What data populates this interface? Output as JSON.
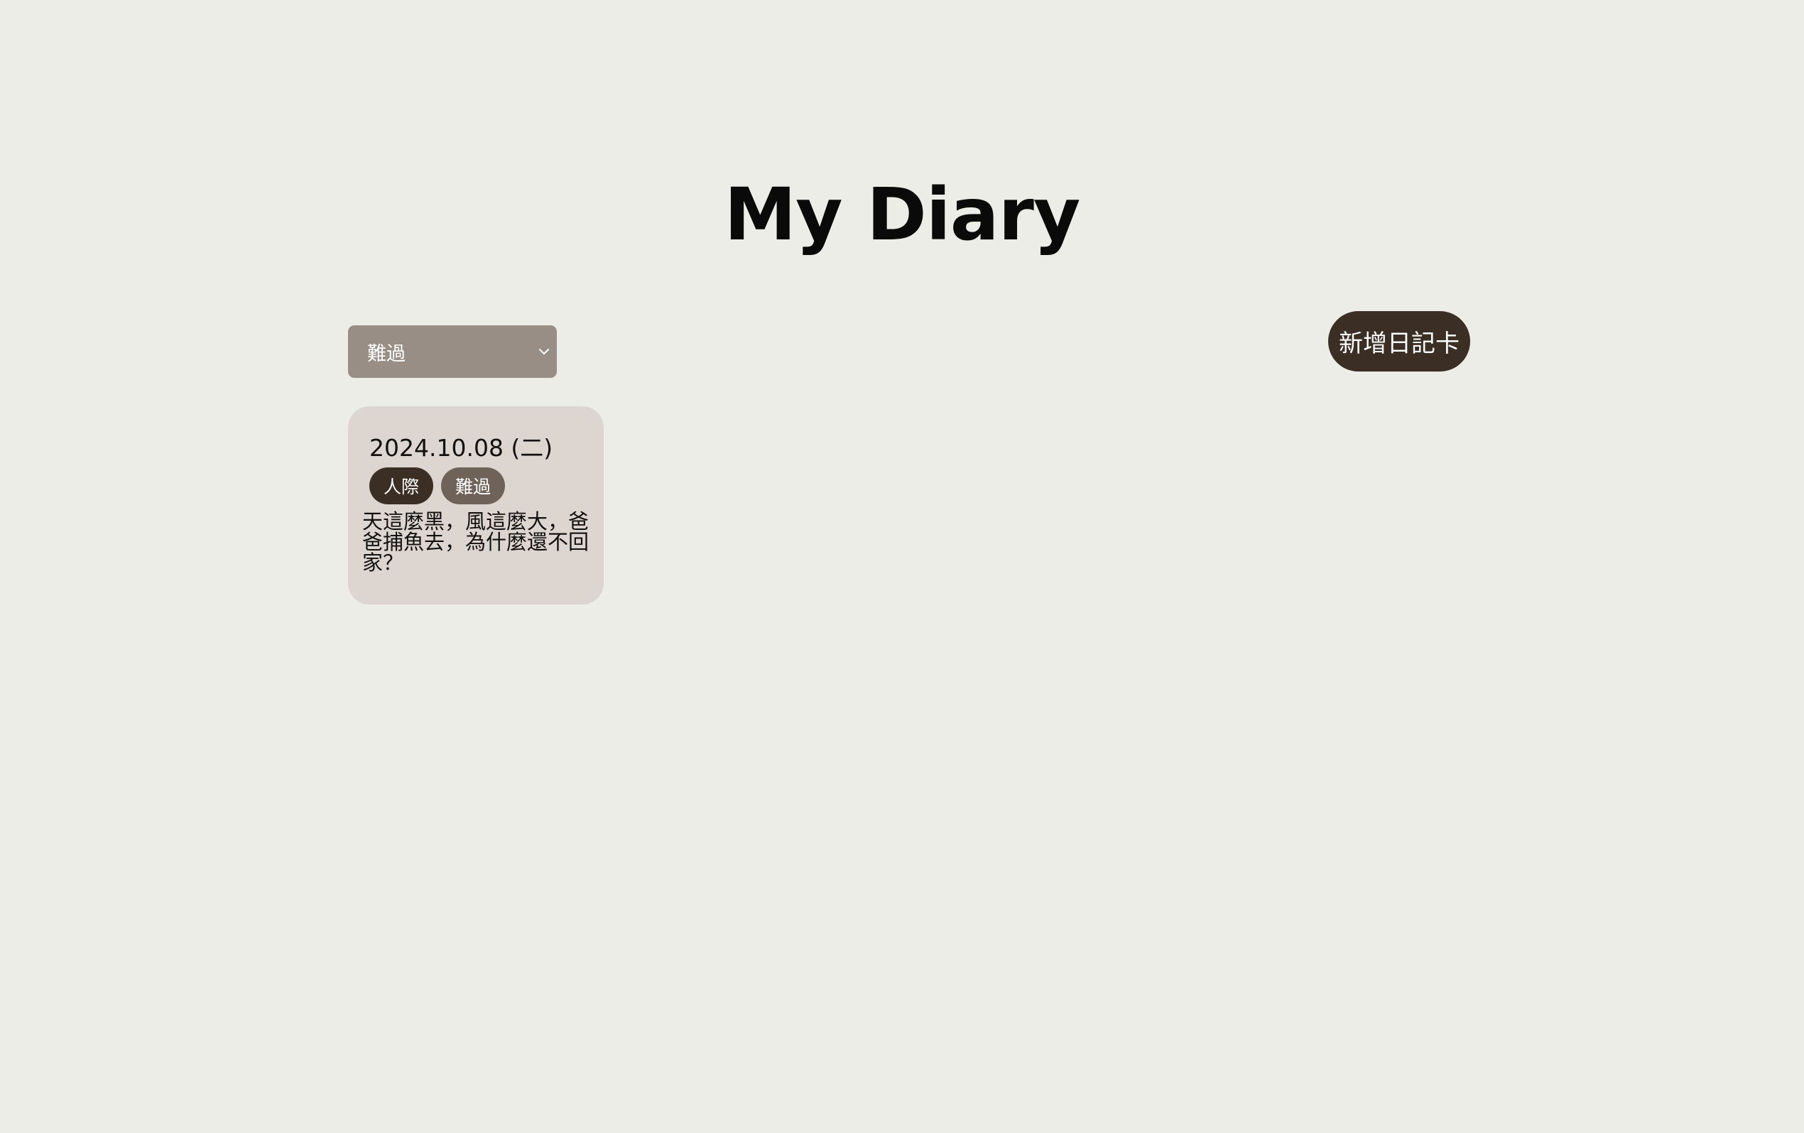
{
  "header": {
    "title": "My Diary"
  },
  "filter": {
    "selected": "難過"
  },
  "actions": {
    "add_label": "新增日記卡"
  },
  "cards": [
    {
      "date": "2024.10.08 (二)",
      "tags": [
        "人際",
        "難過"
      ],
      "content": "天這麼黑，風這麼大，爸爸捕魚去，為什麼還不回家？"
    }
  ],
  "colors": {
    "background": "#edede8",
    "select": "#998e86",
    "button": "#3b2f25",
    "card": "#ddd5cf",
    "tag_primary": "#3b2f25",
    "tag_secondary": "#6e6259"
  },
  "icons": {
    "select_chevron": "chevron-down-icon"
  }
}
